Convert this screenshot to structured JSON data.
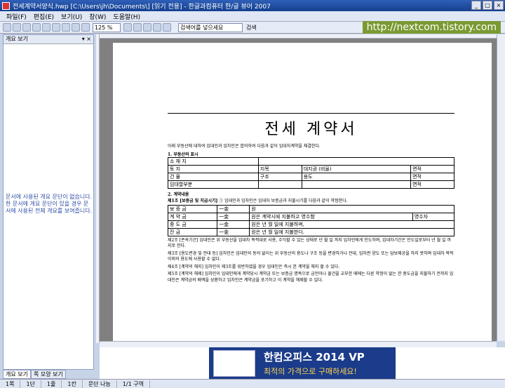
{
  "window": {
    "title": "전세계약서양식.hwp [C:\\Users\\jh\\Documents\\] [읽기 전용] - 한글과컴퓨터 한/글 뷰어 2007"
  },
  "menu": [
    "파일(F)",
    "편집(E)",
    "보기(U)",
    "창(W)",
    "도움말(H)"
  ],
  "toolbar": {
    "zoom": "125 %",
    "search_placeholder": "검색어를 넣으세요",
    "search_label": "검색"
  },
  "watermark": "http://nextcom.tistory.com",
  "sidepanel": {
    "title": "개요 보기",
    "message": "문서에 사용된 개요 문단이 없습니다. 한 문서에 개요 문단이 있을 경우 문서에 사용된 전체 개요를 보여줍니다.",
    "tabs": [
      "개요 보기",
      "쪽 모양 보기"
    ]
  },
  "document": {
    "title": "전세 계약서",
    "intro": "아래 부동산에 대하여 임대인과 임차인은 합의하여 다음과 같이 임대차계약을 체결한다.",
    "section1": "1. 부동산의 표시",
    "property_rows": [
      [
        "소 재 지",
        "",
        "",
        ""
      ],
      [
        "토 지",
        "지목",
        "대지권 (비율)",
        "면적"
      ],
      [
        "건 물",
        "구조",
        "용도",
        "면적"
      ],
      [
        "임대할부분",
        "",
        "",
        "면적"
      ]
    ],
    "unit": "㎡",
    "section2": "2. 계약내용",
    "article1_head": "제1조 [보증금 및 지급시기]",
    "article1_text": "① 임대인과 임차인은 임대차 보증금과 지불시기를 다음과 같이 약정한다.",
    "money_rows": [
      [
        "보 증 금",
        "一金",
        "원"
      ],
      [
        "계 약 금",
        "一金",
        "원은 계약시에 지불하고 영수함",
        "영수자"
      ],
      [
        "중 도 금",
        "一金",
        "원은 년 월 일에 지불하며,"
      ],
      [
        "잔 금",
        "一金",
        "원은 년 월 일에 지불한다."
      ]
    ],
    "paragraphs": [
      "제2조 [존속기간] 임대인은 위 부동산을 임대차 목적대로 사용, 수익할 수 있는 상태로 년 월 일 까지 임차인에게 인도하며, 임대차기간은 인도일로부터 년 월 일 까지로 한다.",
      "제3조 [용도변경 및 전대 등] 임차인은 임대인의 동의 없이는 위 부동산의 용도나 구조 등을 변경하거나 전대, 임차권 양도 또는 담보제공을 하지 못하며 임대차 목적 이외의 용도에 사용할 수 없다.",
      "제4조 [계약의 해지] 임차인이 제3조를 위반하였을 경우 임대인은 즉시 본 계약을 해지 할 수 있다.",
      "제5조 [계약의 해제] 임차인이 임대인에게 계약당시 계약금 또는 보증금 명목으로 금전이나 물건을 교부한 때에는 다른 약정이 없는 한 중도금을 지불하기 전까지 임대인은 계약금의 배액을 상환하고 임차인은 계약금을 포기하고 이 계약을 해제할 수 있다."
    ]
  },
  "ad": {
    "line1": "한컴오피스 2014 VP",
    "line2": "최적의 가격으로 구매하세요!"
  },
  "status": [
    "1쪽",
    "1단",
    "1줄",
    "1칸",
    "문단 나눔",
    "1/1 구역"
  ]
}
